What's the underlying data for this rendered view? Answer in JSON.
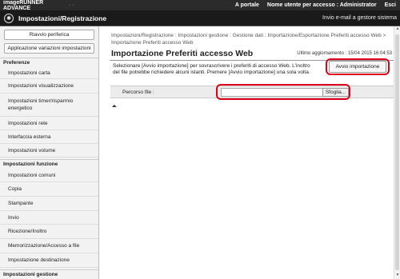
{
  "topbar": {
    "brand": "imageRUNNER ADVANCE",
    "device": "· ·",
    "portal_link": "A portale",
    "user_label": "Nome utente per accesso : Administrator",
    "logout_link": "Esci"
  },
  "titlebar": {
    "title": "Impostazioni/Registrazione",
    "mail_link": "Invio e-mail a gestore sistema"
  },
  "sidebar": {
    "restart_button": "Riavvio periferica",
    "apply_button": "Applicazione variazioni impostazioni",
    "sections": [
      {
        "title": "Preferenze",
        "items": [
          "Impostazioni carta",
          "Impostazioni visualizzazione",
          "Impostazioni timer/risparmio energetico",
          "Impostazioni rete",
          "Interfaccia esterna",
          "Impostazioni volume"
        ]
      },
      {
        "title": "Impostazioni funzione",
        "items": [
          "Impostazioni comuni",
          "Copia",
          "Stampante",
          "Invio",
          "Ricezione/Inoltro",
          "Memorizzazione/Accesso a file",
          "Impostazione destinazione"
        ]
      },
      {
        "title": "Impostazioni gestione",
        "items": []
      }
    ]
  },
  "main": {
    "breadcrumb": "Impostazioni/Registrazione : Impostazioni gestione : Gestione dati : Importazione/Esportazione Preferiti accesso Web > Importazione Preferiti accesso Web",
    "page_title": "Importazione Preferiti accesso Web",
    "last_update": "Ultimo aggiornamento : 15/04 2015 16:04:53",
    "description": "Selezionare [Avvio importazione] per sovrascrivere i preferiti di accesso Web. L'inoltro del file potrebbe richiedere alcuni istanti. Premere [Avvio importazione] una sola volta.",
    "start_button": "Avvio importazione",
    "file_path_label": "Percorso file :",
    "file_path_value": "",
    "browse_button": "Sfoglia...",
    "top_icon": "⏶"
  },
  "colors": {
    "highlight_ring": "#e0001b",
    "header_bg": "#1a1a1a"
  }
}
